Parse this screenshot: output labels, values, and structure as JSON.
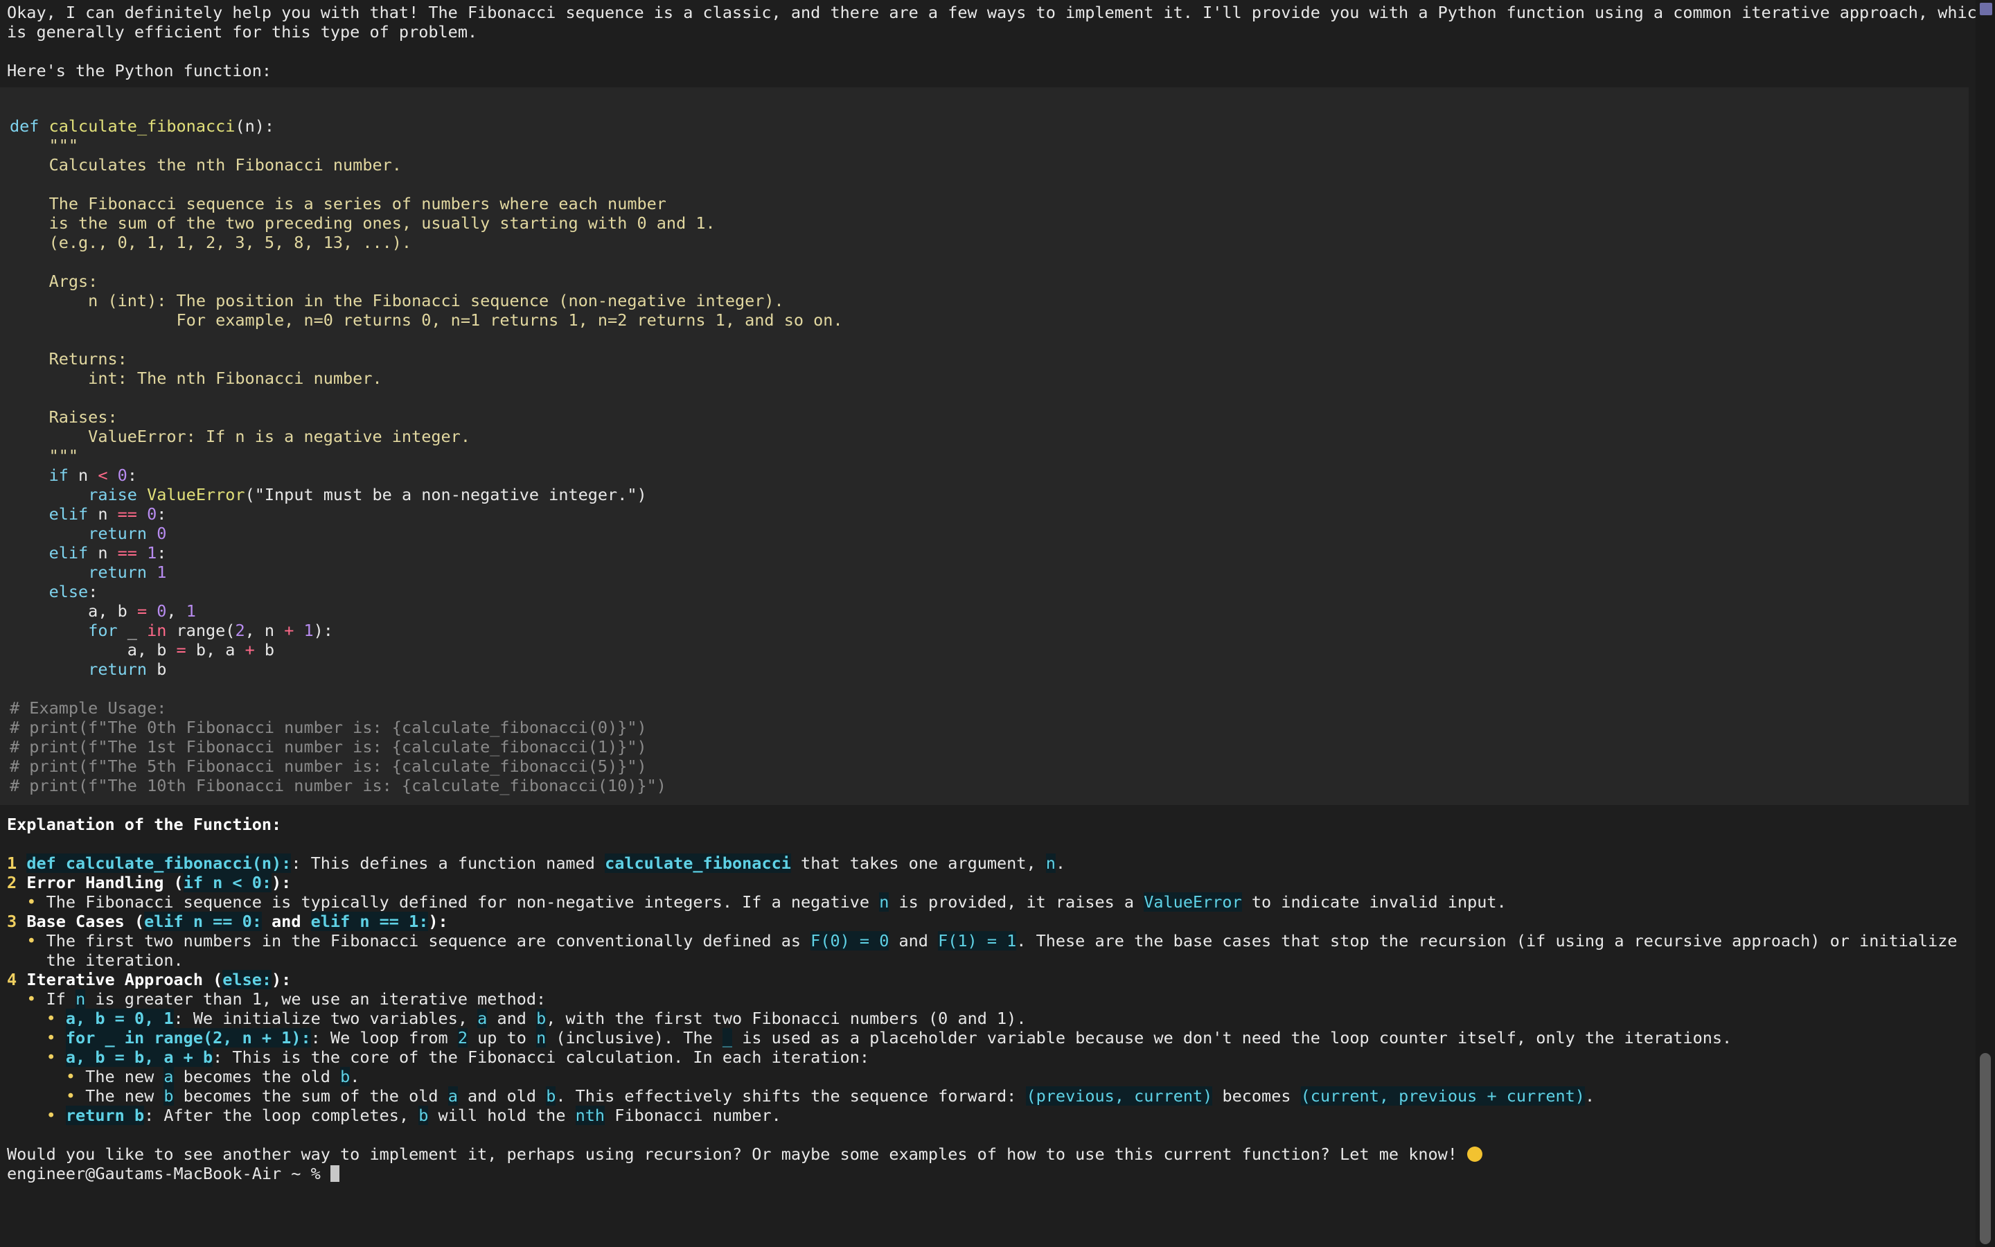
{
  "intro": {
    "line1": "Okay, I can definitely help you with that! The Fibonacci sequence is a classic, and there are a few ways to implement it. I'll provide you with a Python function using a common iterative approach, which",
    "line2": "is generally efficient for this type of problem.",
    "line3": "Here's the Python function:"
  },
  "code": {
    "def_kw": "def",
    "fn_name": "calculate_fibonacci",
    "fn_args": "(n):",
    "doc": [
      "    \"\"\"",
      "    Calculates the nth Fibonacci number.",
      "",
      "    The Fibonacci sequence is a series of numbers where each number",
      "    is the sum of the two preceding ones, usually starting with 0 and 1.",
      "    (e.g., 0, 1, 1, 2, 3, 5, 8, 13, ...).",
      "",
      "    Args:",
      "        n (int): The position in the Fibonacci sequence (non-negative integer).",
      "                 For example, n=0 returns 0, n=1 returns 1, n=2 returns 1, and so on.",
      "",
      "    Returns:",
      "        int: The nth Fibonacci number.",
      "",
      "    Raises:",
      "        ValueError: If n is a negative integer.",
      "    \"\"\""
    ],
    "raise_msg": "(\"Input must be a non-negative integer.\")",
    "comments": [
      "# Example Usage:",
      "# print(f\"The 0th Fibonacci number is: {calculate_fibonacci(0)}\")",
      "# print(f\"The 1st Fibonacci number is: {calculate_fibonacci(1)}\")",
      "# print(f\"The 5th Fibonacci number is: {calculate_fibonacci(5)}\")",
      "# print(f\"The 10th Fibonacci number is: {calculate_fibonacci(10)}\")"
    ]
  },
  "explanation": {
    "heading": "Explanation of the Function:",
    "item1_code": "def calculate_fibonacci(n):",
    "item1_text": ": This defines a function named ",
    "item1_fn": "calculate_fibonacci",
    "item1_tail": " that takes one argument, ",
    "item1_arg": "n",
    "item2_title": "Error Handling (",
    "item2_code": "if n < 0:",
    "item2_bullet": "The Fibonacci sequence is typically defined for non-negative integers. If a negative ",
    "item2_bullet_mid": " is provided, it raises a ",
    "item2_err": "ValueError",
    "item2_bullet_tail": " to indicate invalid input.",
    "item3_title": "Base Cases (",
    "item3_code1": "elif n == 0:",
    "item3_and": " and ",
    "item3_code2": "elif n == 1:",
    "item3_bullet": "The first two numbers in the Fibonacci sequence are conventionally defined as ",
    "item3_f0": "F(0) = 0",
    "item3_f1": "F(1) = 1",
    "item3_bullet_tail": ". These are the base cases that stop the recursion (if using a recursive approach) or initialize",
    "item3_wrap": "the iteration.",
    "item4_title": "Iterative Approach (",
    "item4_code": "else:",
    "item4_bullet_a": "If ",
    "item4_bullet_b": " is greater than 1, we use an iterative method:",
    "sub1_code": "a, b = 0, 1",
    "sub1_text": ": We initialize two variables, ",
    "sub1_b": ", with the first two Fibonacci numbers (0 and 1).",
    "sub2_code": "for _ in range(2, n + 1):",
    "sub2_text": ": We loop from ",
    "sub2_two": "2",
    "sub2_upto": " up to ",
    "sub2_incl": " (inclusive). The ",
    "sub2_tail": " is used as a placeholder variable because we don't need the loop counter itself, only the iterations.",
    "sub3_code": "a, b = b, a + b",
    "sub3_text": ": This is the core of the Fibonacci calculation. In each iteration:",
    "sub3a_text": "The new ",
    "sub3a_mid": " becomes the old ",
    "sub3b_text": "The new ",
    "sub3b_mid": " becomes the sum of the old ",
    "sub3b_and": " and old ",
    "sub3b_tail": ". This effectively shifts the sequence forward: ",
    "sub3b_prev": "(previous, current)",
    "sub3b_becomes": " becomes ",
    "sub3b_next": "(current, previous + current)",
    "sub4_code": "return b",
    "sub4_text": ": After the loop completes, ",
    "sub4_hold": " will hold the ",
    "sub4_nth": "nth",
    "sub4_tail": " Fibonacci number."
  },
  "outro": "Would you like to see another way to implement it, perhaps using recursion? Or maybe some examples of how to use this current function? Let me know! ",
  "prompt": "engineer@Gautams-MacBook-Air ~ % "
}
